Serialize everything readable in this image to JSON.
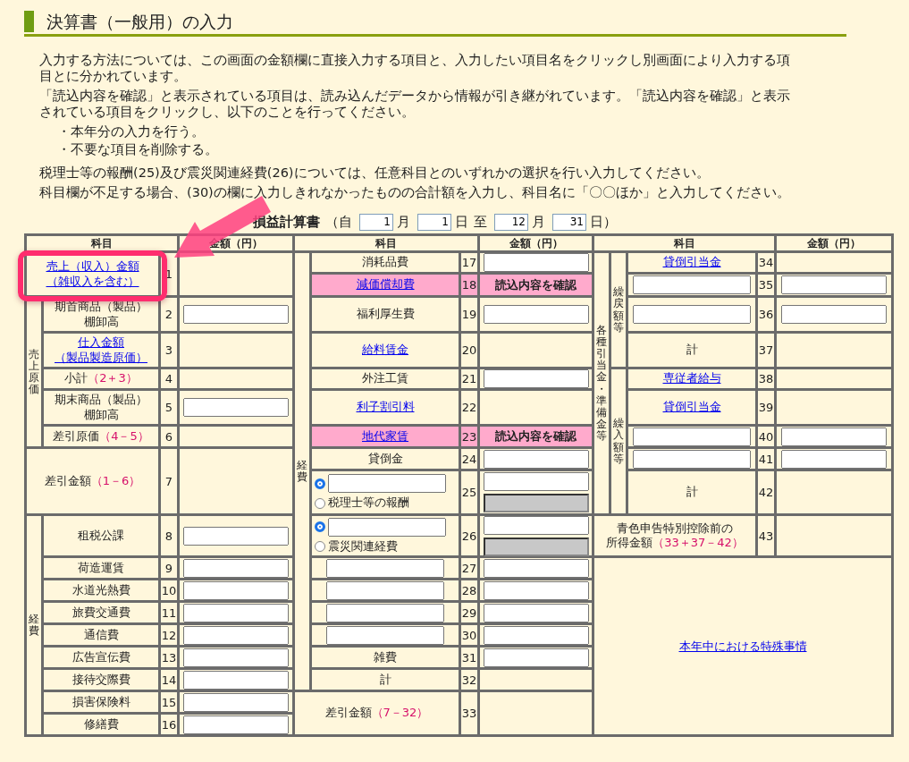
{
  "title": "決算書（一般用）の入力",
  "intro": [
    {
      "kind": "para",
      "text": "入力する方法については、この画面の金額欄に直接入力する項目と、入力したい項目名をクリックし別画面により入力する項目とに分かれています。"
    },
    {
      "kind": "para",
      "text": "「読込内容を確認」と表示されている項目は、読み込んだデータから情報が引き継がれています。「読込内容を確認」と表示されている項目をクリックし、以下のことを行ってください。"
    },
    {
      "kind": "bullet",
      "text": "・本年分の入力を行う。"
    },
    {
      "kind": "bullet",
      "text": "・不要な項目を削除する。"
    },
    {
      "kind": "gap"
    },
    {
      "kind": "para",
      "text": "税理士等の報酬(25)及び震災関連経費(26)については、任意科目とのいずれかの選択を行い入力してください。"
    },
    {
      "kind": "para",
      "text": "科目欄が不足する場合、(30)の欄に入力しきれなかったものの合計額を入力し、科目名に「〇〇ほか」と入力してください。"
    }
  ],
  "statement": {
    "title": "損益計算書",
    "parts": [
      {
        "kind": "text",
        "text": "（自"
      },
      {
        "kind": "input",
        "value": "1"
      },
      {
        "kind": "text",
        "text": "月"
      },
      {
        "kind": "input",
        "value": "1"
      },
      {
        "kind": "text",
        "text": "日"
      },
      {
        "kind": "text",
        "text": "至"
      },
      {
        "kind": "input",
        "value": "12"
      },
      {
        "kind": "text",
        "text": "月"
      },
      {
        "kind": "input",
        "value": "31"
      },
      {
        "kind": "text",
        "text": "日）"
      }
    ]
  },
  "sections": [
    {
      "headers": [
        "科目",
        "金額（円）"
      ],
      "items": [
        {
          "kind": "row",
          "no": "1",
          "name": {
            "kind": "link",
            "lines": [
              "売上（収入）金額",
              "（雑収入を含む）"
            ]
          },
          "highlighted": false
        },
        {
          "kind": "group",
          "label": "売上原価",
          "children": [
            {
              "kind": "row",
              "no": "2",
              "name": {
                "kind": "text",
                "lines": [
                  "期首商品（製品）",
                  "棚卸高"
                ]
              },
              "amount": {
                "kind": "field"
              },
              "highlighted": false
            },
            {
              "kind": "row",
              "no": "3",
              "name": {
                "kind": "link",
                "lines": [
                  "仕入金額",
                  "（製品製造原価）"
                ]
              },
              "highlighted": false
            },
            {
              "kind": "row",
              "no": "4",
              "name": {
                "kind": "text",
                "lines": [
                  "小計"
                ],
                "formula": "（2＋3）"
              },
              "highlighted": false
            },
            {
              "kind": "row",
              "no": "5",
              "name": {
                "kind": "text",
                "lines": [
                  "期末商品（製品）",
                  "棚卸高"
                ]
              },
              "amount": {
                "kind": "field"
              },
              "highlighted": false
            },
            {
              "kind": "row",
              "no": "6",
              "name": {
                "kind": "text",
                "lines": [
                  "差引原価"
                ],
                "formula": "（4－5）"
              },
              "highlighted": false
            }
          ]
        },
        {
          "kind": "row",
          "no": "7",
          "name": {
            "kind": "text",
            "lines": [
              "差引金額"
            ],
            "formula": "（1－6）"
          },
          "highlighted": false
        },
        {
          "kind": "group",
          "label": "経費",
          "children": [
            {
              "kind": "row",
              "no": "8",
              "name": {
                "kind": "text",
                "lines": [
                  "租税公課"
                ]
              },
              "amount": {
                "kind": "field"
              },
              "highlighted": false
            },
            {
              "kind": "row",
              "no": "9",
              "name": {
                "kind": "text",
                "lines": [
                  "荷造運賃"
                ]
              },
              "amount": {
                "kind": "field"
              },
              "highlighted": false
            },
            {
              "kind": "row",
              "no": "10",
              "name": {
                "kind": "text",
                "lines": [
                  "水道光熱費"
                ]
              },
              "amount": {
                "kind": "field"
              },
              "highlighted": false
            },
            {
              "kind": "row",
              "no": "11",
              "name": {
                "kind": "text",
                "lines": [
                  "旅費交通費"
                ]
              },
              "amount": {
                "kind": "field"
              },
              "highlighted": false
            },
            {
              "kind": "row",
              "no": "12",
              "name": {
                "kind": "text",
                "lines": [
                  "通信費"
                ]
              },
              "amount": {
                "kind": "field"
              },
              "highlighted": false
            },
            {
              "kind": "row",
              "no": "13",
              "name": {
                "kind": "text",
                "lines": [
                  "広告宣伝費"
                ]
              },
              "amount": {
                "kind": "field"
              },
              "highlighted": false
            },
            {
              "kind": "row",
              "no": "14",
              "name": {
                "kind": "text",
                "lines": [
                  "接待交際費"
                ]
              },
              "amount": {
                "kind": "field"
              },
              "highlighted": false
            },
            {
              "kind": "row",
              "no": "15",
              "name": {
                "kind": "text",
                "lines": [
                  "損害保険料"
                ]
              },
              "amount": {
                "kind": "field"
              },
              "highlighted": false
            },
            {
              "kind": "row",
              "no": "16",
              "name": {
                "kind": "text",
                "lines": [
                  "修繕費"
                ]
              },
              "amount": {
                "kind": "field"
              },
              "highlighted": false
            }
          ]
        }
      ]
    },
    {
      "headers": [
        "科目",
        "金額（円）"
      ],
      "items": [
        {
          "kind": "group",
          "label": "経費",
          "children": [
            {
              "kind": "row",
              "no": "17",
              "name": {
                "kind": "text",
                "lines": [
                  "消耗品費"
                ]
              },
              "amount": {
                "kind": "field"
              },
              "highlighted": false
            },
            {
              "kind": "row",
              "no": "18",
              "name": {
                "kind": "link",
                "lines": [
                  "減価償却費"
                ]
              },
              "amount": {
                "kind": "status",
                "text": "読込内容を確認"
              },
              "highlighted": true
            },
            {
              "kind": "row",
              "no": "19",
              "name": {
                "kind": "text",
                "lines": [
                  "福利厚生費"
                ]
              },
              "amount": {
                "kind": "field"
              },
              "highlighted": false
            },
            {
              "kind": "row",
              "no": "20",
              "name": {
                "kind": "link",
                "lines": [
                  "給料賃金"
                ]
              },
              "highlighted": false
            },
            {
              "kind": "row",
              "no": "21",
              "name": {
                "kind": "text",
                "lines": [
                  "外注工賃"
                ]
              },
              "amount": {
                "kind": "field"
              },
              "highlighted": false
            },
            {
              "kind": "row",
              "no": "22",
              "name": {
                "kind": "link",
                "lines": [
                  "利子割引料"
                ]
              },
              "highlighted": false
            },
            {
              "kind": "row",
              "no": "23",
              "name": {
                "kind": "link",
                "lines": [
                  "地代家賃"
                ]
              },
              "amount": {
                "kind": "status",
                "text": "読込内容を確認"
              },
              "highlighted": true
            },
            {
              "kind": "row",
              "no": "24",
              "name": {
                "kind": "text",
                "lines": [
                  "貸倒金"
                ]
              },
              "amount": {
                "kind": "field"
              },
              "highlighted": false
            },
            {
              "kind": "choice",
              "no": "25",
              "options": [
                {
                  "selected": true,
                  "name": {
                    "kind": "field"
                  },
                  "amount": {
                    "kind": "field",
                    "disabled": false
                  }
                },
                {
                  "selected": false,
                  "name": {
                    "kind": "text",
                    "lines": [
                      "税理士等の報酬"
                    ]
                  },
                  "amount": {
                    "kind": "field",
                    "disabled": true
                  }
                }
              ]
            },
            {
              "kind": "choice",
              "no": "26",
              "options": [
                {
                  "selected": true,
                  "name": {
                    "kind": "field"
                  },
                  "amount": {
                    "kind": "field",
                    "disabled": false
                  }
                },
                {
                  "selected": false,
                  "name": {
                    "kind": "text",
                    "lines": [
                      "震災関連経費"
                    ]
                  },
                  "amount": {
                    "kind": "field",
                    "disabled": true
                  }
                }
              ]
            },
            {
              "kind": "row",
              "no": "27",
              "name": {
                "kind": "field"
              },
              "amount": {
                "kind": "field"
              },
              "highlighted": false
            },
            {
              "kind": "row",
              "no": "28",
              "name": {
                "kind": "field"
              },
              "amount": {
                "kind": "field"
              },
              "highlighted": false
            },
            {
              "kind": "row",
              "no": "29",
              "name": {
                "kind": "field"
              },
              "amount": {
                "kind": "field"
              },
              "highlighted": false
            },
            {
              "kind": "row",
              "no": "30",
              "name": {
                "kind": "field"
              },
              "amount": {
                "kind": "field"
              },
              "highlighted": false
            },
            {
              "kind": "row",
              "no": "31",
              "name": {
                "kind": "text",
                "lines": [
                  "雑費"
                ]
              },
              "amount": {
                "kind": "field"
              },
              "highlighted": false
            },
            {
              "kind": "row",
              "no": "32",
              "name": {
                "kind": "text",
                "lines": [
                  "計"
                ]
              },
              "highlighted": false
            }
          ]
        },
        {
          "kind": "row",
          "no": "33",
          "name": {
            "kind": "text",
            "lines": [
              "差引金額"
            ],
            "formula": "（7－32）"
          },
          "highlighted": false
        }
      ]
    },
    {
      "headers": [
        "科目",
        "金額（円）"
      ],
      "items": [
        {
          "kind": "group",
          "label": "各種引当金・準備金等",
          "children": [
            {
              "kind": "group",
              "label": "繰戻額等",
              "children": [
                {
                  "kind": "row",
                  "no": "34",
                  "name": {
                    "kind": "link",
                    "lines": [
                      "貸倒引当金"
                    ]
                  },
                  "highlighted": false
                },
                {
                  "kind": "row",
                  "no": "35",
                  "name": {
                    "kind": "field"
                  },
                  "amount": {
                    "kind": "field"
                  },
                  "highlighted": false
                },
                {
                  "kind": "row",
                  "no": "36",
                  "name": {
                    "kind": "field"
                  },
                  "amount": {
                    "kind": "field"
                  },
                  "highlighted": false
                },
                {
                  "kind": "row",
                  "no": "37",
                  "name": {
                    "kind": "text",
                    "lines": [
                      "計"
                    ]
                  },
                  "highlighted": false
                }
              ]
            },
            {
              "kind": "group",
              "label": "繰入額等",
              "children": [
                {
                  "kind": "row",
                  "no": "38",
                  "name": {
                    "kind": "link",
                    "lines": [
                      "専従者給与"
                    ]
                  },
                  "highlighted": false
                },
                {
                  "kind": "row",
                  "no": "39",
                  "name": {
                    "kind": "link",
                    "lines": [
                      "貸倒引当金"
                    ]
                  },
                  "highlighted": false
                },
                {
                  "kind": "row",
                  "no": "40",
                  "name": {
                    "kind": "field"
                  },
                  "amount": {
                    "kind": "field"
                  },
                  "highlighted": false
                },
                {
                  "kind": "row",
                  "no": "41",
                  "name": {
                    "kind": "field"
                  },
                  "amount": {
                    "kind": "field"
                  },
                  "highlighted": false
                },
                {
                  "kind": "row",
                  "no": "42",
                  "name": {
                    "kind": "text",
                    "lines": [
                      "計"
                    ]
                  },
                  "highlighted": false
                }
              ]
            }
          ]
        },
        {
          "kind": "row",
          "no": "43",
          "name": {
            "kind": "text",
            "lines": [
              "青色申告特別控除前の",
              "所得金額"
            ],
            "formula": "（33＋37－42）"
          },
          "highlighted": false
        },
        {
          "kind": "special",
          "label": "本年中における特殊事情"
        }
      ]
    }
  ]
}
